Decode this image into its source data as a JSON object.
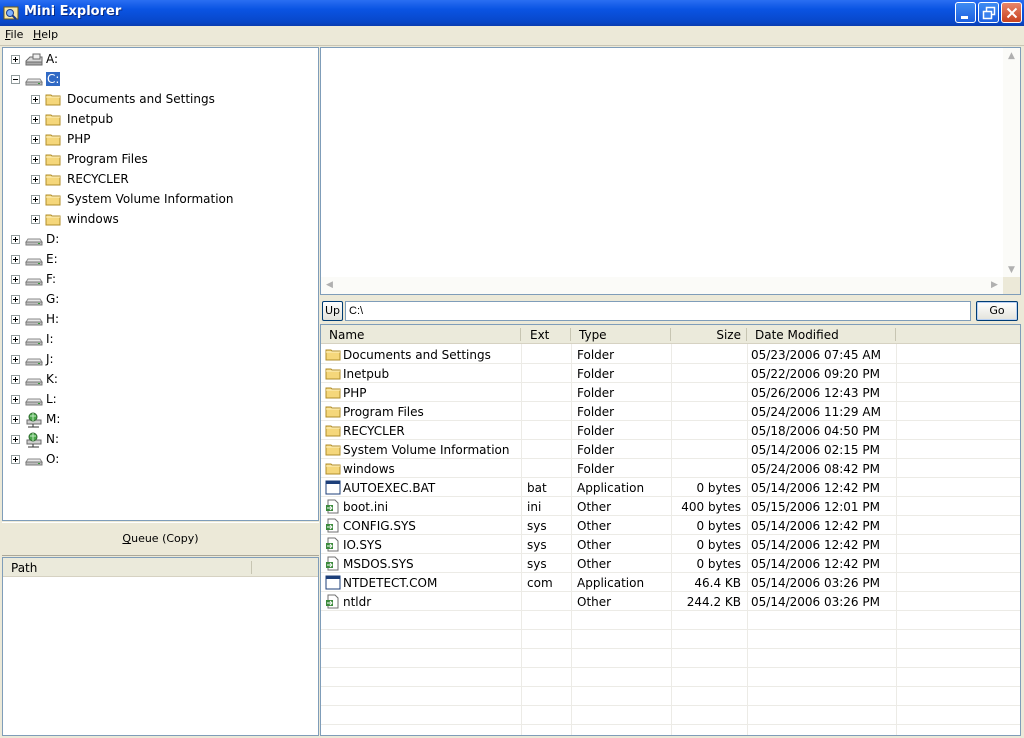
{
  "window": {
    "title": "Mini Explorer"
  },
  "menu": [
    {
      "label": "File",
      "accel": "F",
      "rest": "ile"
    },
    {
      "label": "Help",
      "accel": "H",
      "rest": "elp"
    }
  ],
  "tree": {
    "drives": [
      {
        "label": "A:",
        "icon": "floppy-drive-icon",
        "expanded": false,
        "selected": false
      },
      {
        "label": "C:",
        "icon": "hard-drive-icon",
        "expanded": true,
        "selected": true,
        "children": [
          {
            "label": "Documents and Settings"
          },
          {
            "label": "Inetpub"
          },
          {
            "label": "PHP"
          },
          {
            "label": "Program Files"
          },
          {
            "label": "RECYCLER"
          },
          {
            "label": "System Volume Information"
          },
          {
            "label": "windows"
          }
        ]
      },
      {
        "label": "D:",
        "icon": "hard-drive-icon",
        "expanded": false,
        "selected": false
      },
      {
        "label": "E:",
        "icon": "hard-drive-icon",
        "expanded": false,
        "selected": false
      },
      {
        "label": "F:",
        "icon": "hard-drive-icon",
        "expanded": false,
        "selected": false
      },
      {
        "label": "G:",
        "icon": "hard-drive-icon",
        "expanded": false,
        "selected": false
      },
      {
        "label": "H:",
        "icon": "hard-drive-icon",
        "expanded": false,
        "selected": false
      },
      {
        "label": "I:",
        "icon": "hard-drive-icon",
        "expanded": false,
        "selected": false
      },
      {
        "label": "J:",
        "icon": "hard-drive-icon",
        "expanded": false,
        "selected": false
      },
      {
        "label": "K:",
        "icon": "hard-drive-icon",
        "expanded": false,
        "selected": false
      },
      {
        "label": "L:",
        "icon": "hard-drive-icon",
        "expanded": false,
        "selected": false
      },
      {
        "label": "M:",
        "icon": "network-drive-icon",
        "expanded": false,
        "selected": false
      },
      {
        "label": "N:",
        "icon": "network-drive-icon",
        "expanded": false,
        "selected": false
      },
      {
        "label": "O:",
        "icon": "hard-drive-icon",
        "expanded": false,
        "selected": false
      }
    ]
  },
  "queue": {
    "button_label": "Queue (Copy)",
    "button_accel": "Q",
    "button_rest": "ueue (Copy)",
    "column_path": "Path"
  },
  "address": {
    "up_label": "Up",
    "path_value": "C:\\",
    "go_label": "Go"
  },
  "files": {
    "columns": [
      "Name",
      "Ext",
      "Type",
      "Size",
      "Date Modified"
    ],
    "rows": [
      {
        "name": "Documents and Settings",
        "ext": "",
        "type": "Folder",
        "size": "",
        "date": "05/23/2006 07:45 AM",
        "icon": "folder-icon"
      },
      {
        "name": "Inetpub",
        "ext": "",
        "type": "Folder",
        "size": "",
        "date": "05/22/2006 09:20 PM",
        "icon": "folder-icon"
      },
      {
        "name": "PHP",
        "ext": "",
        "type": "Folder",
        "size": "",
        "date": "05/26/2006 12:43 PM",
        "icon": "folder-icon"
      },
      {
        "name": "Program Files",
        "ext": "",
        "type": "Folder",
        "size": "",
        "date": "05/24/2006 11:29 AM",
        "icon": "folder-icon"
      },
      {
        "name": "RECYCLER",
        "ext": "",
        "type": "Folder",
        "size": "",
        "date": "05/18/2006 04:50 PM",
        "icon": "folder-icon"
      },
      {
        "name": "System Volume Information",
        "ext": "",
        "type": "Folder",
        "size": "",
        "date": "05/14/2006 02:15 PM",
        "icon": "folder-icon"
      },
      {
        "name": "windows",
        "ext": "",
        "type": "Folder",
        "size": "",
        "date": "05/24/2006 08:42 PM",
        "icon": "folder-icon"
      },
      {
        "name": "AUTOEXEC.BAT",
        "ext": "bat",
        "type": "Application",
        "size": "0 bytes",
        "date": "05/14/2006 12:42 PM",
        "icon": "application-icon"
      },
      {
        "name": "boot.ini",
        "ext": "ini",
        "type": "Other",
        "size": "400 bytes",
        "date": "05/15/2006 12:01 PM",
        "icon": "generic-file-icon"
      },
      {
        "name": "CONFIG.SYS",
        "ext": "sys",
        "type": "Other",
        "size": "0 bytes",
        "date": "05/14/2006 12:42 PM",
        "icon": "generic-file-icon"
      },
      {
        "name": "IO.SYS",
        "ext": "sys",
        "type": "Other",
        "size": "0 bytes",
        "date": "05/14/2006 12:42 PM",
        "icon": "generic-file-icon"
      },
      {
        "name": "MSDOS.SYS",
        "ext": "sys",
        "type": "Other",
        "size": "0 bytes",
        "date": "05/14/2006 12:42 PM",
        "icon": "generic-file-icon"
      },
      {
        "name": "NTDETECT.COM",
        "ext": "com",
        "type": "Application",
        "size": "46.4 KB",
        "date": "05/14/2006 03:26 PM",
        "icon": "application-icon"
      },
      {
        "name": "ntldr",
        "ext": "",
        "type": "Other",
        "size": "244.2 KB",
        "date": "05/14/2006 03:26 PM",
        "icon": "generic-file-icon"
      }
    ]
  },
  "colors": {
    "titlebar": "#0a54e3",
    "selection": "#316ac5",
    "folder": "#f5d77b"
  }
}
